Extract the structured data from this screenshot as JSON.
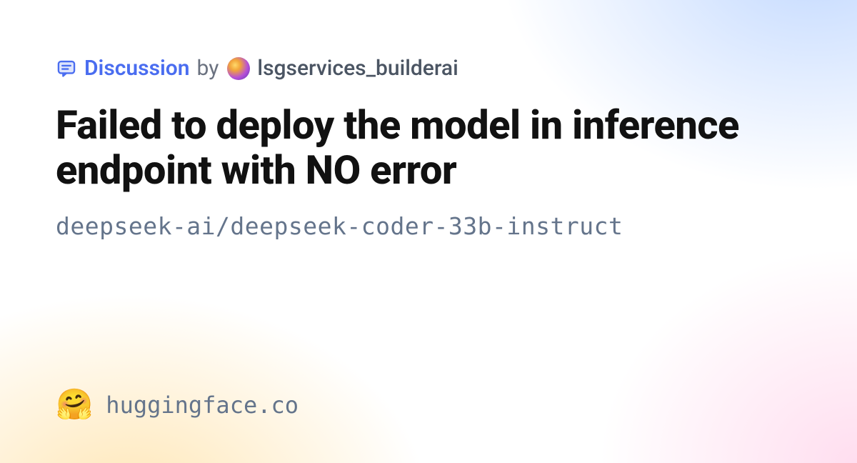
{
  "meta": {
    "discussion_label": "Discussion",
    "by_label": "by",
    "username": "lsgservices_builderai"
  },
  "title": "Failed to deploy the model in inference endpoint with NO error",
  "repo": "deepseek-ai/deepseek-coder-33b-instruct",
  "footer": {
    "site": "huggingface.co"
  }
}
